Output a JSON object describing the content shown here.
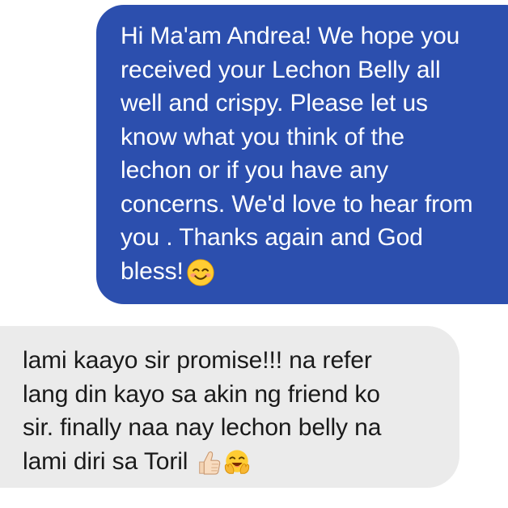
{
  "messages": [
    {
      "direction": "outgoing",
      "bubble_color": "#2c4fae",
      "text_color": "#ffffff",
      "lines": [
        "Hi Ma'am Andrea! We hope you",
        "received your Lechon Belly all",
        "well and crispy. Please let us",
        "know what you think of the",
        "lechon or if you have any",
        "concerns. We'd love to hear from",
        "you . Thanks again and God",
        "bless!"
      ],
      "trailing_emoji": [
        "smiling-face-with-smiling-eyes-icon"
      ]
    },
    {
      "direction": "incoming",
      "bubble_color": "#ebebeb",
      "text_color": "#1a1a1a",
      "lines": [
        "lami kaayo sir promise!!! na refer",
        "lang din kayo sa akin ng friend ko",
        "sir. finally naa nay lechon belly na",
        "lami diri sa Toril"
      ],
      "trailing_emoji": [
        "thumbs-up-icon",
        "hugging-face-icon"
      ]
    }
  ]
}
